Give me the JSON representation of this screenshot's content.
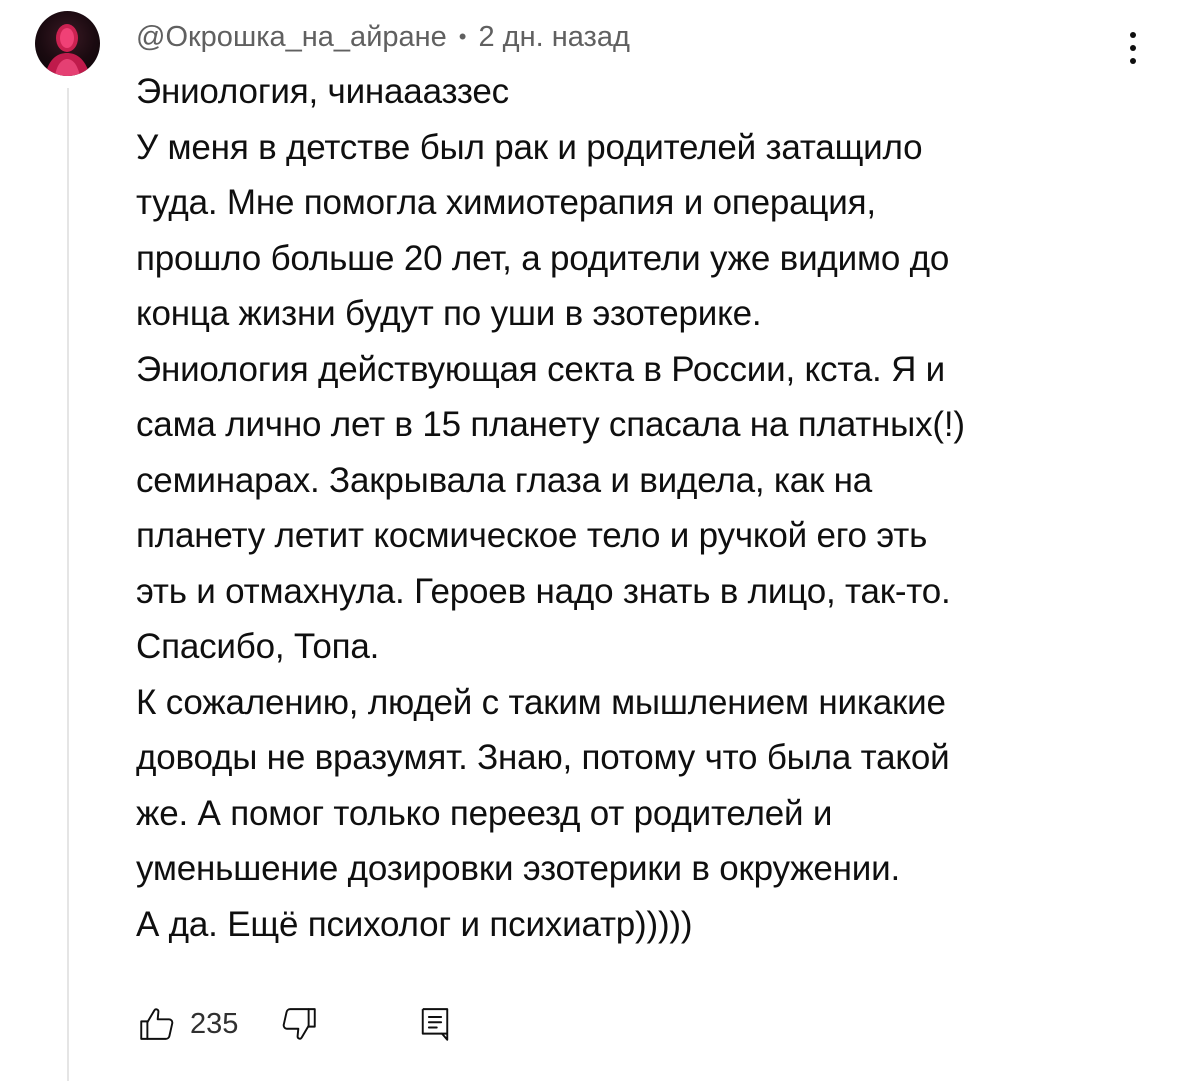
{
  "comment": {
    "author": "@Окрошка_на_айране",
    "separator": "•",
    "timestamp": "2 дн. назад",
    "lines": [
      "Эниология, чинаааззес",
      "У меня в детстве был рак и родителей затащило",
      "туда. Мне помогла химиотерапия и операция,",
      "прошло больше 20 лет, а родители уже видимо до",
      "конца жизни будут по уши в эзотерике.",
      "Эниология действующая секта в России, кста. Я и",
      "сама лично лет в 15 планету спасала на платных(!)",
      "семинарах. Закрывала глаза и видела, как на",
      "планету летит космическое тело и ручкой его эть",
      "эть и отмахнула. Героев надо знать в лицо, так-то.",
      "Спасибо, Топа.",
      "К сожалению, людей с таким мышлением никакие",
      "доводы не вразумят. Знаю, потому что была такой",
      "же. А помог только переезд от родителей и",
      "уменьшение дозировки эзотерики в окружении.",
      "А да. Ещё психолог и психиатр)))))"
    ],
    "like_count": "235"
  },
  "icons": {
    "menu": "more-vertical-icon",
    "like": "thumbs-up-icon",
    "dislike": "thumbs-down-icon",
    "reply": "reply-icon"
  },
  "colors": {
    "text": "#0f0f0f",
    "secondary": "#606060",
    "thread_line": "#e5e5e5",
    "avatar_accent": "#e6245a"
  }
}
